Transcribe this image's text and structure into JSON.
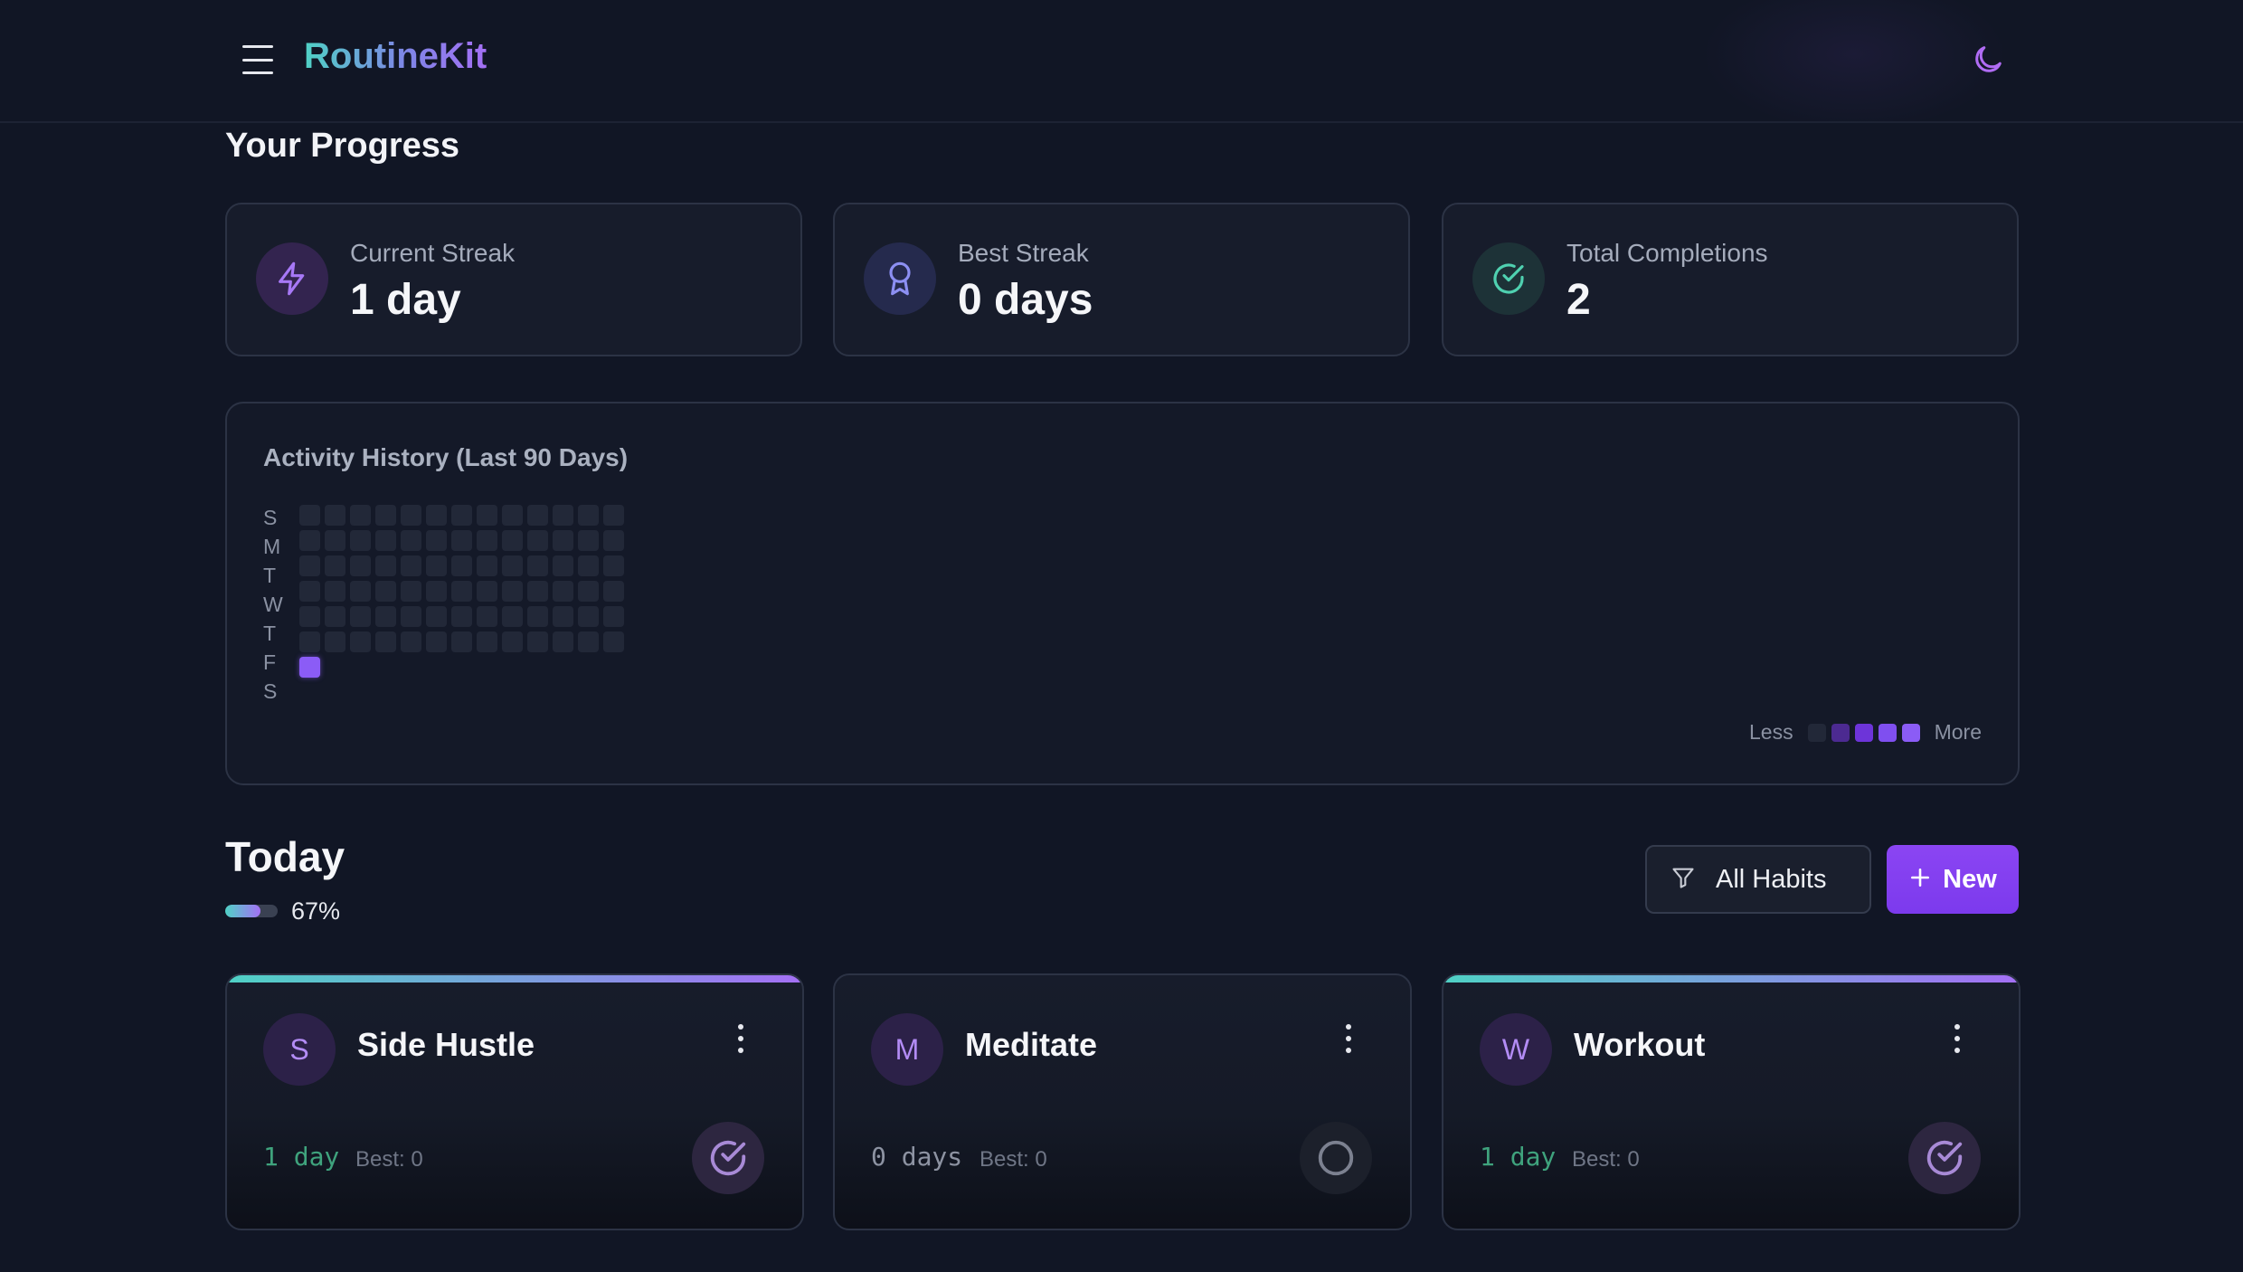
{
  "header": {
    "brand": "RoutineKit",
    "menu_icon": "menu-icon",
    "theme_icon": "moon-icon"
  },
  "progress": {
    "title": "Your Progress",
    "stats": [
      {
        "label": "Current Streak",
        "value": "1 day",
        "icon": "bolt-icon"
      },
      {
        "label": "Best Streak",
        "value": "0 days",
        "icon": "award-icon"
      },
      {
        "label": "Total Completions",
        "value": "2",
        "icon": "check-circle-icon"
      }
    ]
  },
  "activity": {
    "title": "Activity History (Last 90 Days)",
    "day_labels": [
      "S",
      "M",
      "T",
      "W",
      "T",
      "F",
      "S"
    ],
    "weeks": 13,
    "active_cells": [
      {
        "week": 0,
        "day": 6,
        "level": 4
      }
    ],
    "legend": {
      "less": "Less",
      "more": "More",
      "colors": [
        "#222838",
        "#4c2a91",
        "#6d34d9",
        "#7f4ff0",
        "#8b5cf6"
      ]
    }
  },
  "today": {
    "title": "Today",
    "progress": 0.67,
    "progress_text": "67%",
    "filter_label": "All Habits",
    "new_label": "New"
  },
  "habits": [
    {
      "initial": "S",
      "name": "Side Hustle",
      "streak": "1 day",
      "best": "Best: 0",
      "done": true
    },
    {
      "initial": "M",
      "name": "Meditate",
      "streak": "0 days",
      "best": "Best: 0",
      "done": false
    },
    {
      "initial": "W",
      "name": "Workout",
      "streak": "1 day",
      "best": "Best: 0",
      "done": true
    }
  ],
  "colors": {
    "accent": "#8b5cf6",
    "teal": "#4fd1c5",
    "streak_green": "#3fa37d",
    "background": "#111625"
  }
}
